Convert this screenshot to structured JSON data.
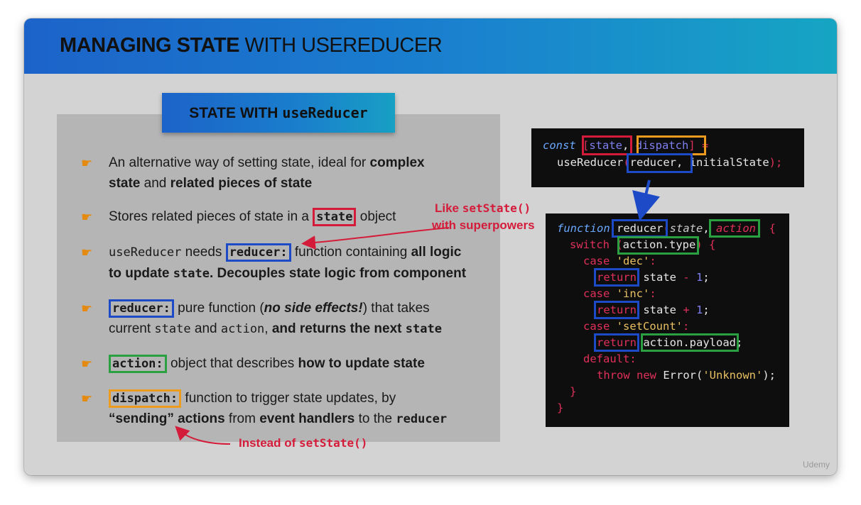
{
  "slide": {
    "title_bold": "MANAGING STATE",
    "title_light": "WITH USEREDUCER",
    "subtitle_bold": "STATE WITH",
    "subtitle_rest": "useReducer",
    "watermark": "Udemy"
  },
  "bullets": [
    {
      "p1": "An alternative way of setting state, ideal for ",
      "p2": "complex",
      "p3": "state",
      "p4": " and ",
      "p5": "related pieces of state"
    },
    {
      "p1": "Stores related pieces of state in a ",
      "kw": "state",
      "p2": " object"
    },
    {
      "code1": "useReducer",
      "p1": " needs ",
      "kw": "reducer",
      "colon": ":",
      "p2": " function containing ",
      "p3": "all logic",
      "p4": "to update ",
      "code2": "state",
      "p5": ". Decouples state logic from component"
    },
    {
      "kw": "reducer",
      "colon": ":",
      "p1": " pure function (",
      "p2": "no side effects!",
      "p3": ") that takes",
      "p4": "current ",
      "code1": "state",
      "p5": " and ",
      "code2": "action",
      "p6": ", ",
      "p7": "and returns the next ",
      "code3": "state"
    },
    {
      "kw": "action",
      "colon": ":",
      "p1": " object that describes ",
      "p2": "how to update state"
    },
    {
      "kw": "dispatch",
      "colon": ":",
      "p1": " function to trigger state updates, by",
      "p2": "“sending” actions",
      "p3": " from ",
      "p4": "event handlers",
      "p5": " to the ",
      "code1": "reducer"
    }
  ],
  "annotations": {
    "like_prefix": "Like ",
    "like_code": "setState()",
    "like_suffix": "with superpowers",
    "instead_prefix": "Instead of ",
    "instead_code": "setState()"
  },
  "code_top": {
    "kw_const": "const ",
    "bracket_open": "[",
    "state": "state",
    "comma1": ", ",
    "dispatch": "dispatch",
    "bracket_close": "]",
    "eq": " =",
    "fn": "useReducer",
    "paren_open": "(",
    "reducer": "reducer",
    "comma2": ", ",
    "initial": "initialState",
    "paren_close": ");"
  },
  "code_bottom": {
    "l1_kw": "function ",
    "l1_name": "reducer",
    "l1_paren": "(",
    "l1_state": "state",
    "l1_comma": ", ",
    "l1_action": "action",
    "l1_close": ") {",
    "l2_kw": "switch ",
    "l2_paren": "(",
    "l2_expr": "action.type",
    "l2_close": ") {",
    "case_kw": "case ",
    "case1_str": "'dec'",
    "colon": ":",
    "return_kw": "return",
    "state_txt": " state ",
    "minus": "-",
    "plus": "+",
    "num1": " 1",
    "semi": ";",
    "case2_str": "'inc'",
    "case3_str": "'setCount'",
    "payload": "action.payload",
    "default_kw": "default",
    "throw_kw": "throw new ",
    "error_fn": "Error(",
    "error_str": "'Unknown'",
    "error_close": ");",
    "brace": "}"
  },
  "colors": {
    "red": "#d41c3a",
    "blue": "#1d4bc7",
    "green": "#2aa043",
    "orange": "#ec9b1e",
    "header_start": "#1c63c9",
    "header_end": "#16a5c3"
  }
}
